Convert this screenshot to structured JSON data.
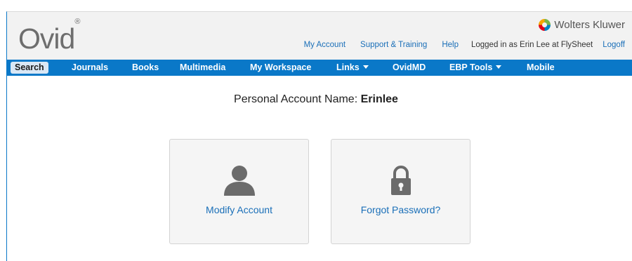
{
  "header": {
    "logo_text": "Ovid",
    "logo_mark": "®",
    "brand_text": "Wolters Kluwer",
    "brand_icon": "wolters-kluwer-logo-icon",
    "links": {
      "my_account": "My Account",
      "support": "Support & Training",
      "help": "Help",
      "logged_in": "Logged in as Erin Lee at FlySheet",
      "logoff": "Logoff"
    }
  },
  "nav": {
    "search": "Search",
    "journals": "Journals",
    "books": "Books",
    "multimedia": "Multimedia",
    "my_workspace": "My Workspace",
    "links": "Links",
    "ovidmd": "OvidMD",
    "ebp_tools": "EBP Tools",
    "mobile": "Mobile"
  },
  "account": {
    "label": "Personal Account Name:",
    "name": "Erinlee"
  },
  "cards": {
    "modify": {
      "label": "Modify Account",
      "icon": "user-icon"
    },
    "forgot": {
      "label": "Forgot Password?",
      "icon": "lock-icon"
    }
  },
  "colors": {
    "nav_bar": "#0a78c8",
    "link": "#1a6fb8",
    "header_bg": "#f2f2f2",
    "icon_gray": "#6b6b6b"
  }
}
